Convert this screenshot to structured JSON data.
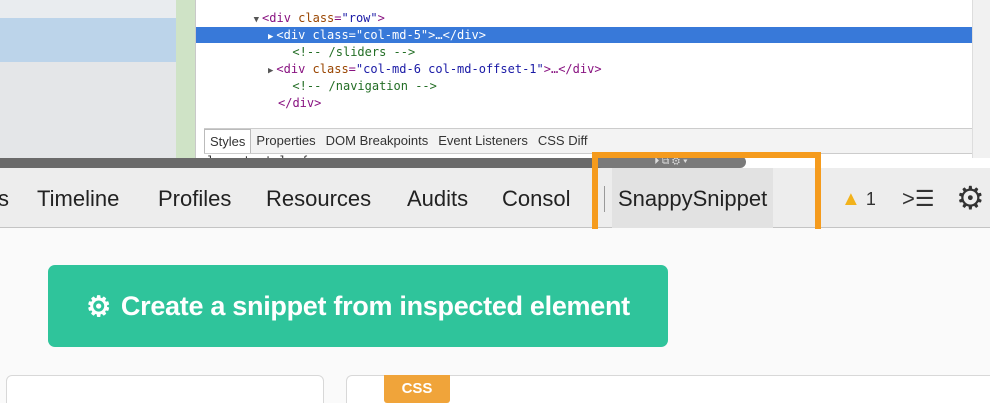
{
  "elements_tree": {
    "lines": [
      {
        "indent": 8,
        "triangle": "▼",
        "parts": [
          [
            "tag",
            "<div "
          ],
          [
            "attr",
            "class"
          ],
          [
            "tag",
            "="
          ],
          [
            "val",
            "\"row\""
          ],
          [
            "tag",
            ">"
          ]
        ]
      },
      {
        "indent": 10,
        "triangle": "▶",
        "parts": [
          [
            "tag",
            "<div "
          ],
          [
            "attr",
            "class"
          ],
          [
            "tag",
            "="
          ],
          [
            "val",
            "\"col-md-5\""
          ],
          [
            "tag",
            ">…</div>"
          ]
        ],
        "selected": true
      },
      {
        "indent": 12,
        "triangle": "",
        "parts": [
          [
            "comment",
            "<!-- /sliders -->"
          ]
        ]
      },
      {
        "indent": 10,
        "triangle": "▶",
        "parts": [
          [
            "tag",
            "<div "
          ],
          [
            "attr",
            "class"
          ],
          [
            "tag",
            "="
          ],
          [
            "val",
            "\"col-md-6 col-md-offset-1\""
          ],
          [
            "tag",
            ">…</div>"
          ]
        ]
      },
      {
        "indent": 12,
        "triangle": "",
        "parts": [
          [
            "comment",
            "<!-- /navigation -->"
          ]
        ]
      },
      {
        "indent": 10,
        "triangle": "",
        "parts": [
          [
            "tag",
            "</div>"
          ]
        ]
      }
    ]
  },
  "sidebar_tabs": [
    "Styles",
    "Properties",
    "DOM Breakpoints",
    "Event Listeners",
    "CSS Diff"
  ],
  "style_line": "element.style {",
  "main_tabs": {
    "partial_label": "s",
    "timeline": "Timeline",
    "profiles": "Profiles",
    "resources": "Resources",
    "audits": "Audits",
    "console": "Consol",
    "snappy": "SnappySnippet"
  },
  "warnings": {
    "icon": "warning-icon",
    "count": "1"
  },
  "drawer_icon": "console-drawer-icon",
  "settings_icon": "gear-icon",
  "create_button": {
    "icon": "gear-icon",
    "label": "Create a snippet from inspected element"
  },
  "css_badge": "CSS",
  "colors": {
    "accent_green": "#2fc49b",
    "highlight_orange": "#f59b1d",
    "selection_blue": "#3879d9",
    "badge_orange": "#f0a43a"
  }
}
